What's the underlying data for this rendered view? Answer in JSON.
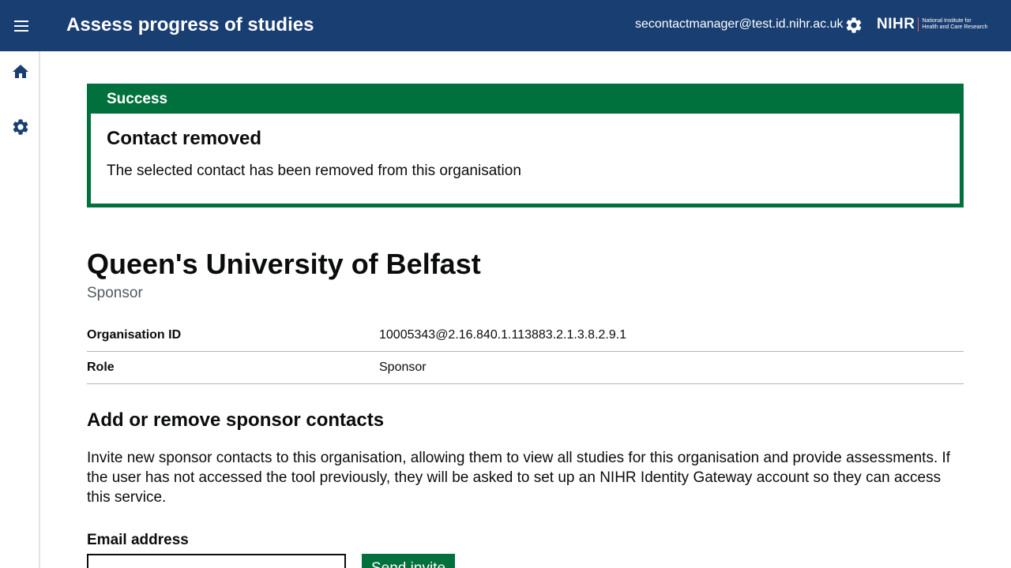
{
  "header": {
    "title": "Assess progress of studies",
    "user_email": "secontactmanager@test.id.nihr.ac.uk",
    "menu_icon": "menu-icon",
    "settings_icon": "gear-icon",
    "logo": {
      "mark": "NIHR",
      "line1": "National Institute for",
      "line2": "Health and Care Research"
    },
    "colors": {
      "background": "#193e72",
      "logo_accent": "#e26b4d"
    }
  },
  "sidebar": {
    "items": [
      {
        "icon": "home-icon"
      },
      {
        "icon": "gear-icon"
      }
    ]
  },
  "banner": {
    "heading": "Success",
    "title": "Contact removed",
    "message": "The selected contact has been removed from this organisation",
    "color": "#00703c"
  },
  "organisation": {
    "name": "Queen's University of Belfast",
    "caption": "Sponsor",
    "summary": [
      {
        "key": "Organisation ID",
        "value": "10005343@2.16.840.1.113883.2.1.3.8.2.9.1"
      },
      {
        "key": "Role",
        "value": "Sponsor"
      }
    ]
  },
  "contacts_section": {
    "title": "Add or remove sponsor contacts",
    "description": "Invite new sponsor contacts to this organisation, allowing them to view all studies for this organisation and provide assessments. If the user has not accessed the tool previously, they will be asked to set up an NIHR Identity Gateway account so they can access this service.",
    "email_label": "Email address",
    "email_value": "",
    "send_button": "Send invite"
  }
}
